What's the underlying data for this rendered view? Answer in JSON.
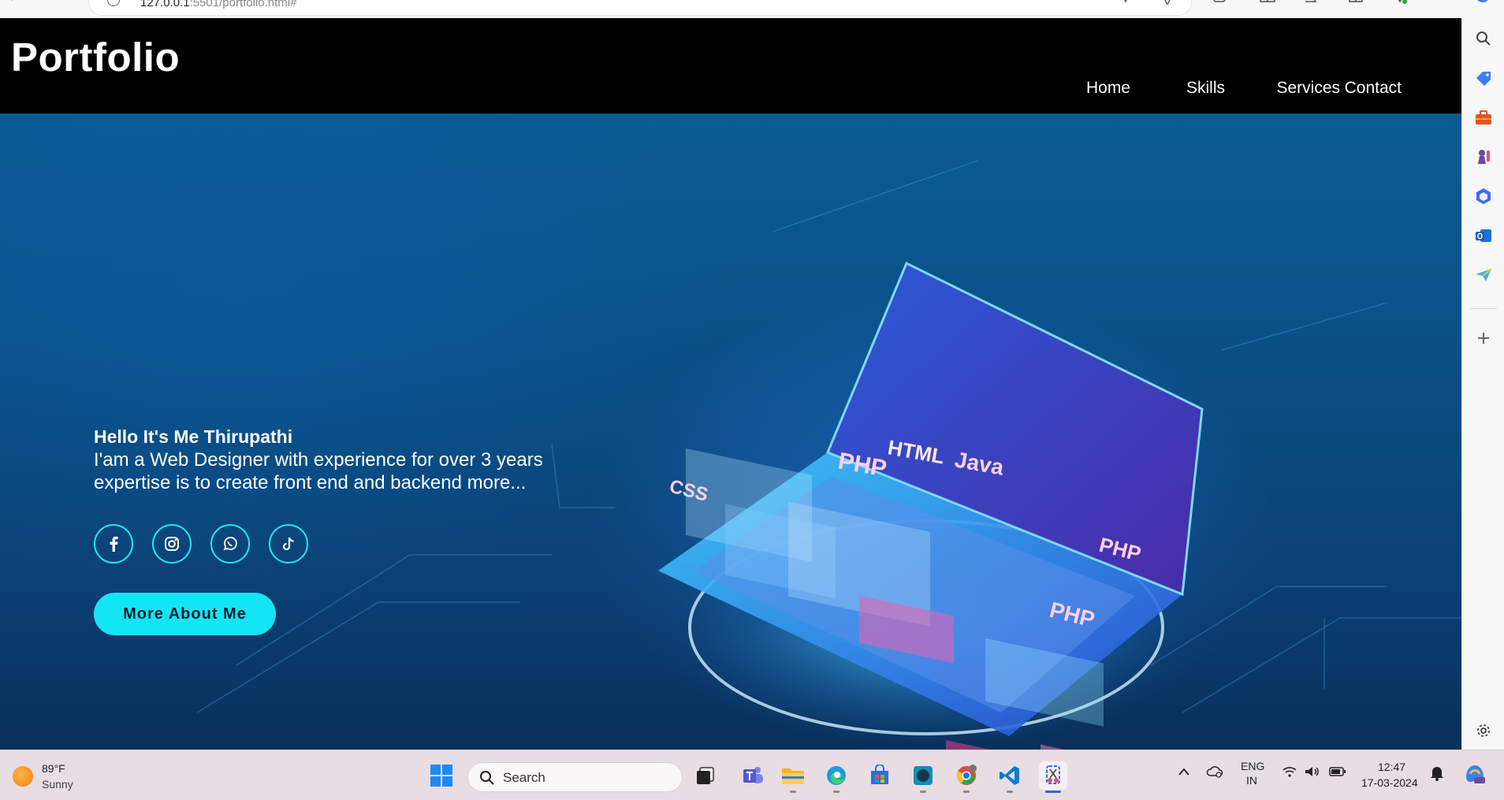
{
  "browser": {
    "url_host": "127.0.0.1",
    "url_rest": ":5501/portfolio.html#"
  },
  "site": {
    "logo": "Portfolio",
    "nav": [
      {
        "label": "Home"
      },
      {
        "label": "Skills"
      },
      {
        "label": "Services"
      },
      {
        "label": "Contact"
      }
    ]
  },
  "hero": {
    "greeting": "Hello It's Me Thirupathi",
    "line1": "I'am a Web Designer with experience for over 3 years",
    "line2": "expertise is to create front end and backend more...",
    "socials": [
      "facebook-icon",
      "instagram-icon",
      "whatsapp-icon",
      "tiktok-icon"
    ],
    "cta_label": "More About Me",
    "art_labels": {
      "php1": "PHP",
      "html": "HTML",
      "java": "Java",
      "css": "CSS",
      "php2": "PHP",
      "php3": "PHP"
    }
  },
  "taskbar": {
    "weather_temp": "89°F",
    "weather_cond": "Sunny",
    "search_placeholder": "Search",
    "lang_top": "ENG",
    "lang_bottom": "IN",
    "time": "12:47",
    "date": "17-03-2024"
  },
  "colors": {
    "accent": "#12e6f5",
    "header_bg": "#000000",
    "hero_blue": "#0a4f86"
  }
}
